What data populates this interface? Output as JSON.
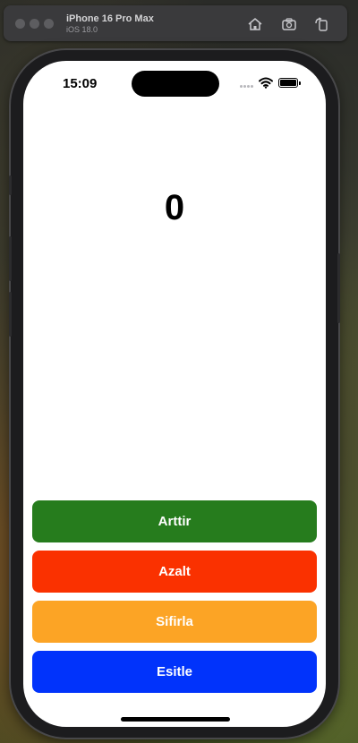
{
  "simulator": {
    "device_name": "iPhone 16 Pro Max",
    "os_version": "iOS 18.0",
    "toolbar_icons": [
      "home-icon",
      "screenshot-icon",
      "rotate-icon"
    ]
  },
  "status_bar": {
    "time": "15:09"
  },
  "counter": {
    "value": "0"
  },
  "buttons": {
    "increment": "Arttir",
    "decrement": "Azalt",
    "reset": "Sifirla",
    "equalize": "Esitle"
  },
  "colors": {
    "increment": "#267c1d",
    "decrement": "#fa3100",
    "reset": "#fca425",
    "equalize": "#0133fb"
  }
}
